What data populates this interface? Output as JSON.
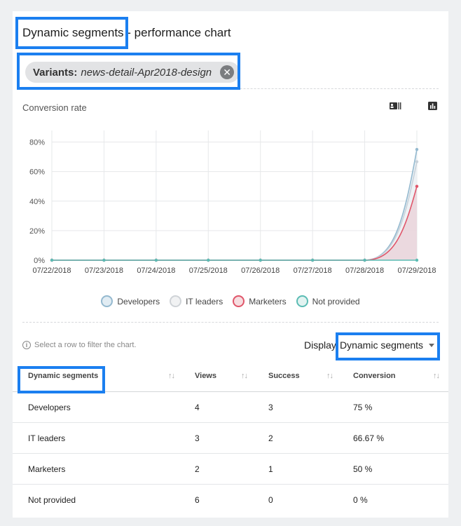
{
  "header": {
    "title_part1": "Dynamic segments",
    "title_sep": " - ",
    "title_part2": "performance chart"
  },
  "filter_chip": {
    "key": "Variants:",
    "value": "news-detail-Apr2018-design",
    "remove_glyph": "✕"
  },
  "chart": {
    "title": "Conversion rate",
    "toolbar_icons": [
      "contact-card-icon",
      "bar-chart-icon"
    ]
  },
  "chart_data": {
    "type": "line",
    "title": "Conversion rate",
    "xlabel": "",
    "ylabel": "",
    "x": [
      "07/22/2018",
      "07/23/2018",
      "07/24/2018",
      "07/25/2018",
      "07/26/2018",
      "07/27/2018",
      "07/28/2018",
      "07/29/2018"
    ],
    "yticks": [
      "0%",
      "20%",
      "40%",
      "60%",
      "80%"
    ],
    "ylim": [
      0,
      85
    ],
    "series": [
      {
        "name": "Developers",
        "values": [
          0,
          0,
          0,
          0,
          0,
          0,
          0,
          75
        ],
        "color": "#94b9cf",
        "fill": "#dfeaf1"
      },
      {
        "name": "IT leaders",
        "values": [
          0,
          0,
          0,
          0,
          0,
          0,
          0,
          66.67
        ],
        "color": "#c9d2da",
        "fill": "#eef1f4"
      },
      {
        "name": "Marketers",
        "values": [
          0,
          0,
          0,
          0,
          0,
          0,
          0,
          50
        ],
        "color": "#e0566a",
        "fill": "#e9c5cc"
      },
      {
        "name": "Not provided",
        "values": [
          0,
          0,
          0,
          0,
          0,
          0,
          0,
          0
        ],
        "color": "#5bbcb4",
        "fill": "#e2f3f1"
      }
    ],
    "grid": true,
    "legend_position": "bottom"
  },
  "legend": [
    {
      "label": "Developers",
      "border": "#94b9cf",
      "fill": "#e1ecf3"
    },
    {
      "label": "IT leaders",
      "border": "#cfd3d7",
      "fill": "#f1f2f3"
    },
    {
      "label": "Marketers",
      "border": "#e0566a",
      "fill": "#f6dde0"
    },
    {
      "label": "Not provided",
      "border": "#5bbcb4",
      "fill": "#e2f3f1"
    }
  ],
  "hint": {
    "icon": "info-icon",
    "text": "Select a row to filter the chart."
  },
  "display": {
    "label": "Display:",
    "value": "Dynamic segments"
  },
  "table": {
    "columns": [
      "Dynamic segments",
      "Views",
      "Success",
      "Conversion"
    ],
    "sort_glyph": "↑↓",
    "rows": [
      [
        "Developers",
        "4",
        "3",
        "75 %"
      ],
      [
        "IT leaders",
        "3",
        "2",
        "66.67 %"
      ],
      [
        "Marketers",
        "2",
        "1",
        "50 %"
      ],
      [
        "Not provided",
        "6",
        "0",
        "0 %"
      ]
    ]
  },
  "colors": {
    "highlight": "#1b7ff0",
    "accent_marketers": "#e0566a"
  }
}
